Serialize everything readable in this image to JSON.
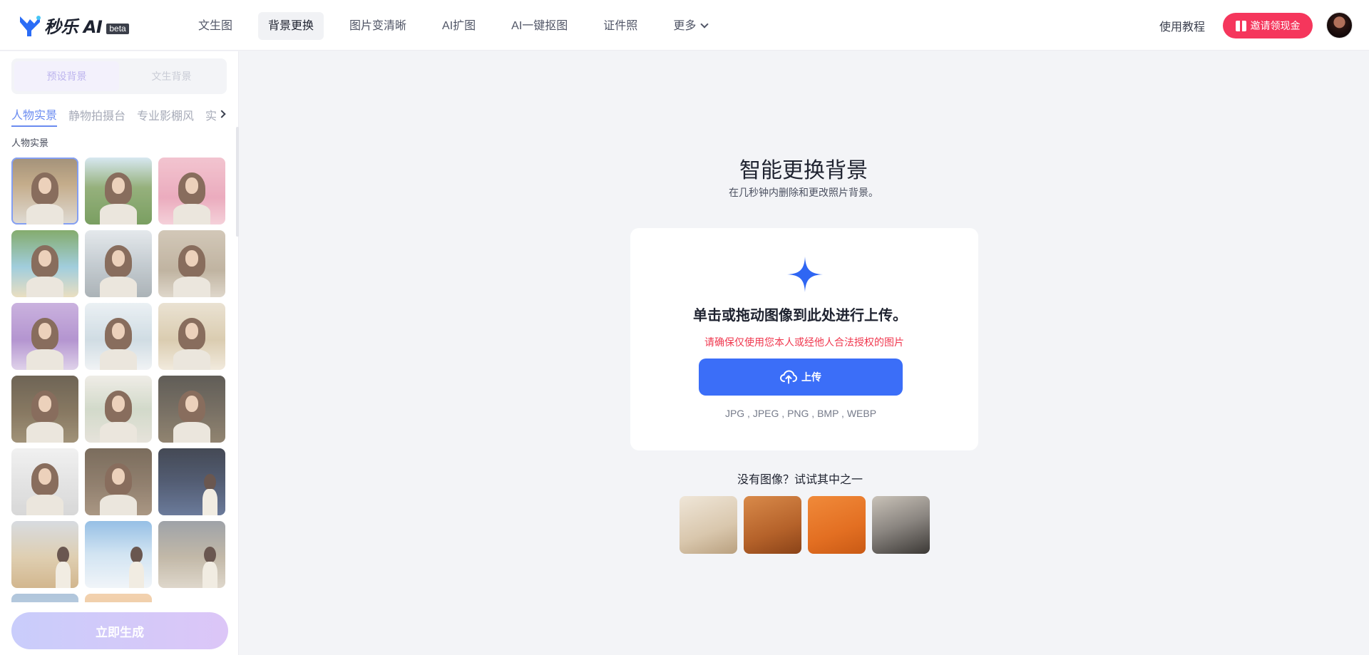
{
  "header": {
    "logo_text": "秒乐 AI",
    "beta_label": "beta",
    "nav": [
      {
        "label": "文生图",
        "active": false
      },
      {
        "label": "背景更换",
        "active": true
      },
      {
        "label": "图片变清晰",
        "active": false
      },
      {
        "label": "AI扩图",
        "active": false
      },
      {
        "label": "AI一键抠图",
        "active": false
      },
      {
        "label": "证件照",
        "active": false
      },
      {
        "label": "更多",
        "active": false
      }
    ],
    "tutorial": "使用教程",
    "invite": "邀请领现金"
  },
  "sidebar": {
    "mode_tabs": [
      "预设背景",
      "文生背景"
    ],
    "categories": [
      "人物实景",
      "静物拍摄台",
      "专业影棚风",
      "实"
    ],
    "section_label": "人物实景",
    "generate_label": "立即生成",
    "thumbnails": [
      {
        "bg": "linear-gradient(180deg,#8f7a5d 0%,#b89b72 40%,#d9d4cc 100%)"
      },
      {
        "bg": "linear-gradient(180deg,#cfe3ee 0%,#7fa060 45%,#5d8a3f 100%)"
      },
      {
        "bg": "linear-gradient(180deg,#f0b8c6 0%,#e79ab0 60%,#f3c7d2 100%)"
      },
      {
        "bg": "linear-gradient(180deg,#6a9a4e 0%,#8dc3d6 55%,#e6d8b4 100%)"
      },
      {
        "bg": "linear-gradient(180deg,#dfe4e8 0%,#b9c2c8 50%,#9aa3a8 100%)"
      },
      {
        "bg": "linear-gradient(180deg,#c9bca9 0%,#b3a48d 60%,#d8cfc0 100%)"
      },
      {
        "bg": "linear-gradient(180deg,#bfa2d8 0%,#a47ec6 55%,#d9c9e6 100%)"
      },
      {
        "bg": "linear-gradient(180deg,#e7eef2 0%,#c6d5de 55%,#eef1f3 100%)"
      },
      {
        "bg": "linear-gradient(180deg,#e6dcc9 0%,#d3c2a0 55%,#efe6d6 100%)"
      },
      {
        "bg": "linear-gradient(180deg,#4f4331 0%,#6e5c40 55%,#8d7b5c 100%)"
      },
      {
        "bg": "linear-gradient(180deg,#ece9e2 0%,#c9d2bf 50%,#e1ddd3 100%)"
      },
      {
        "bg": "linear-gradient(180deg,#3e3a33 0%,#5d5344 55%,#7a6a52 100%)"
      },
      {
        "bg": "linear-gradient(180deg,#eeeeee 0%,#dddddd 55%,#cfcfcf 100%)"
      },
      {
        "bg": "linear-gradient(180deg,#5e4d3a 0%,#7a6550 55%,#988169 100%)"
      },
      {
        "bg": "linear-gradient(180deg,#1c2230 0%,#2e3a55 50%,#4b5e85 100%)",
        "solo": true
      },
      {
        "bg": "linear-gradient(180deg,#cfd4da 0%,#d8c4a0 55%,#c9a776 100%)",
        "solo": true
      },
      {
        "bg": "linear-gradient(180deg,#7fb2e0 0%,#c9dff0 50%,#eef3f8 100%)",
        "solo": true
      },
      {
        "bg": "linear-gradient(180deg,#8a8f96 0%,#b6aa96 55%,#d8cfc0 100%)",
        "solo": true
      },
      {
        "bg": "linear-gradient(180deg,#9fb9d4 0%,#c8d7e4 100%)"
      },
      {
        "bg": "linear-gradient(180deg,#f0c89e 0%,#e8b27a 100%)"
      }
    ]
  },
  "main": {
    "title": "智能更换背景",
    "subtitle": "在几秒钟内删除和更改照片背景。",
    "drop_text": "单击或拖动图像到此处进行上传。",
    "notice": "请确保仅使用您本人或经他人合法授权的图片",
    "upload_label": "上传",
    "formats": "JPG , JPEG , PNG , BMP , WEBP",
    "try_text": "没有图像？试试其中之一",
    "samples": [
      {
        "name": "sample-perfume-bottle",
        "bg": "linear-gradient(160deg,#efe6d8 0%,#d9c7ad 60%,#b9a07f 100%)"
      },
      {
        "name": "sample-handbag",
        "bg": "linear-gradient(160deg,#d98a4a 0%,#b5622a 60%,#8a4318 100%)"
      },
      {
        "name": "sample-corgi-dog",
        "bg": "linear-gradient(160deg,#f08a3a 0%,#e36f22 60%,#c95a15 100%)"
      },
      {
        "name": "sample-woman-portrait",
        "bg": "linear-gradient(160deg,#c9c2b8 0%,#8a8580 50%,#3b3835 100%)"
      }
    ]
  }
}
